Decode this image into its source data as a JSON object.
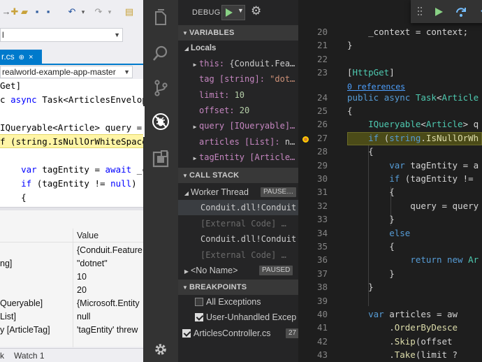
{
  "vs": {
    "combo_value": "l",
    "tab_label": "r.cs",
    "tab_pin": "⊕",
    "tab_close": "×",
    "project_value": "realworld-example-app-master",
    "code_lines": [
      {
        "text": "Get]"
      },
      {
        "pre": "c ",
        "kw": "async",
        "rest": " Task<ArticlesEnvelope"
      },
      {
        "text": ""
      },
      {
        "pre": "IQueryable<Article> query = _c"
      },
      {
        "pre": "f (string.IsNullOrWhiteSpace(t"
      },
      {
        "text": ""
      },
      {
        "pre": "    ",
        "kw": "var",
        "rest": " tagEntity = ",
        "kw2": "await",
        "rest2": " _con"
      },
      {
        "pre": "    ",
        "kw": "if",
        "rest": " (tagEntity != ",
        "kw2": "null",
        "rest2": ")"
      },
      {
        "text": "    {"
      }
    ],
    "locals_header_value": "Value",
    "locals_rows": [
      {
        "name": "",
        "value": "{Conduit.Feature"
      },
      {
        "name": "ng]",
        "value": "\"dotnet\""
      },
      {
        "name": "",
        "value": "10"
      },
      {
        "name": "",
        "value": "20"
      },
      {
        "name": "Queryable]",
        "value": "{Microsoft.Entity"
      },
      {
        "name": "List]",
        "value": "null"
      },
      {
        "name": "y [ArticleTag]",
        "value": "'tagEntity' threw"
      }
    ],
    "bottom_tabs": [
      "k",
      "Watch 1"
    ]
  },
  "vscode": {
    "debug_label": "DEBUG",
    "sections": {
      "variables": "VARIABLES",
      "call_stack": "CALL STACK",
      "breakpoints": "BREAKPOINTS"
    },
    "locals_label": "Locals",
    "variables": [
      {
        "arrow": "▶",
        "name": "this:",
        "value": " {Conduit.Fea…",
        "vclass": "plain"
      },
      {
        "arrow": "",
        "name": "tag [string]:",
        "value": " \"dot…",
        "vclass": "str"
      },
      {
        "arrow": "",
        "name": "limit:",
        "value": " 10",
        "vclass": "num"
      },
      {
        "arrow": "",
        "name": "offset:",
        "value": " 20",
        "vclass": "num"
      },
      {
        "arrow": "▶",
        "name": "query [IQueryable]…",
        "value": "",
        "vclass": "plain"
      },
      {
        "arrow": "",
        "name": "articles [List]:",
        "value": " n…",
        "vclass": "plain"
      },
      {
        "arrow": "▶",
        "name": "tagEntity [Article…",
        "value": "",
        "vclass": "plain"
      }
    ],
    "call_stack": {
      "thread": "Worker Thread",
      "thread_badge": "PAUSE…",
      "frames": [
        {
          "text": "Conduit.dll!Conduit",
          "kind": "selected"
        },
        {
          "text": "[External Code] …",
          "kind": "external"
        },
        {
          "text": "Conduit.dll!Conduit",
          "kind": "normal"
        },
        {
          "text": "[External Code] …",
          "kind": "external"
        }
      ],
      "no_name": "<No Name>",
      "no_name_badge": "PAUSED"
    },
    "breakpoints": [
      {
        "label": "All Exceptions",
        "checked": false,
        "count": ""
      },
      {
        "label": "User-Unhandled Excep",
        "checked": true,
        "count": ""
      },
      {
        "label": "ArticlesController.cs",
        "checked": true,
        "count": "27"
      }
    ],
    "editor": {
      "codelens": "0 references",
      "lines": [
        {
          "n": "20",
          "code": [
            [
              "",
              "    _context = context;"
            ]
          ]
        },
        {
          "n": "21",
          "code": [
            [
              "",
              "}"
            ]
          ]
        },
        {
          "n": "22",
          "code": [
            [
              "",
              ""
            ]
          ]
        },
        {
          "n": "23",
          "code": [
            [
              "",
              "["
            ],
            [
              "attr",
              "HttpGet"
            ],
            [
              "",
              "]"
            ]
          ]
        },
        {
          "n": "24",
          "code": [
            [
              "kw",
              "public"
            ],
            [
              "",
              " "
            ],
            [
              "kw",
              "async"
            ],
            [
              "",
              " "
            ],
            [
              "ty",
              "Task"
            ],
            [
              "",
              "<"
            ],
            [
              "ty",
              "Article"
            ]
          ]
        },
        {
          "n": "25",
          "code": [
            [
              "",
              "{"
            ]
          ]
        },
        {
          "n": "26",
          "code": [
            [
              "",
              "    "
            ],
            [
              "ty",
              "IQueryable"
            ],
            [
              "",
              "<"
            ],
            [
              "ty",
              "Article"
            ],
            [
              "",
              "> q"
            ]
          ]
        },
        {
          "n": "27",
          "code": [
            [
              "",
              "    "
            ],
            [
              "kw",
              "if"
            ],
            [
              "",
              " ("
            ],
            [
              "kw",
              "string"
            ],
            [
              "",
              "."
            ],
            [
              "yl",
              "IsNullOrWh"
            ]
          ]
        },
        {
          "n": "28",
          "code": [
            [
              "",
              "    {"
            ]
          ]
        },
        {
          "n": "29",
          "code": [
            [
              "",
              "        "
            ],
            [
              "kw",
              "var"
            ],
            [
              "",
              " tagEntity = a"
            ]
          ]
        },
        {
          "n": "30",
          "code": [
            [
              "",
              "        "
            ],
            [
              "kw",
              "if"
            ],
            [
              "",
              " (tagEntity != "
            ]
          ]
        },
        {
          "n": "31",
          "code": [
            [
              "",
              "        {"
            ]
          ]
        },
        {
          "n": "32",
          "code": [
            [
              "",
              "            query = query"
            ]
          ]
        },
        {
          "n": "33",
          "code": [
            [
              "",
              "        }"
            ]
          ]
        },
        {
          "n": "34",
          "code": [
            [
              "",
              "        "
            ],
            [
              "kw",
              "else"
            ]
          ]
        },
        {
          "n": "35",
          "code": [
            [
              "",
              "        {"
            ]
          ]
        },
        {
          "n": "36",
          "code": [
            [
              "",
              "            "
            ],
            [
              "kw",
              "return"
            ],
            [
              "",
              " "
            ],
            [
              "kw",
              "new"
            ],
            [
              "",
              " "
            ],
            [
              "ty",
              "Ar"
            ]
          ]
        },
        {
          "n": "37",
          "code": [
            [
              "",
              "        }"
            ]
          ]
        },
        {
          "n": "38",
          "code": [
            [
              "",
              "    }"
            ]
          ]
        },
        {
          "n": "39",
          "code": [
            [
              "",
              ""
            ]
          ]
        },
        {
          "n": "40",
          "code": [
            [
              "",
              "    "
            ],
            [
              "kw",
              "var"
            ],
            [
              "",
              " articles = aw"
            ]
          ]
        },
        {
          "n": "41",
          "code": [
            [
              "",
              "        ."
            ],
            [
              "yl",
              "OrderByDesce"
            ]
          ]
        },
        {
          "n": "42",
          "code": [
            [
              "",
              "        ."
            ],
            [
              "yl",
              "Skip"
            ],
            [
              "",
              "(offset"
            ]
          ]
        },
        {
          "n": "43",
          "code": [
            [
              "",
              "        ."
            ],
            [
              "yl",
              "Take"
            ],
            [
              "",
              "(limit ?"
            ]
          ]
        }
      ]
    },
    "icons": {
      "explorer": "files-icon",
      "search": "search-icon",
      "scm": "source-control-icon",
      "debug": "debug-icon",
      "extensions": "extensions-icon",
      "settings": "gear-icon"
    },
    "colors": {
      "continue": "#89d185",
      "step": "#75beff",
      "restart": "#89d185",
      "stop": "#f48771",
      "current_line": "#4b4b18"
    }
  }
}
